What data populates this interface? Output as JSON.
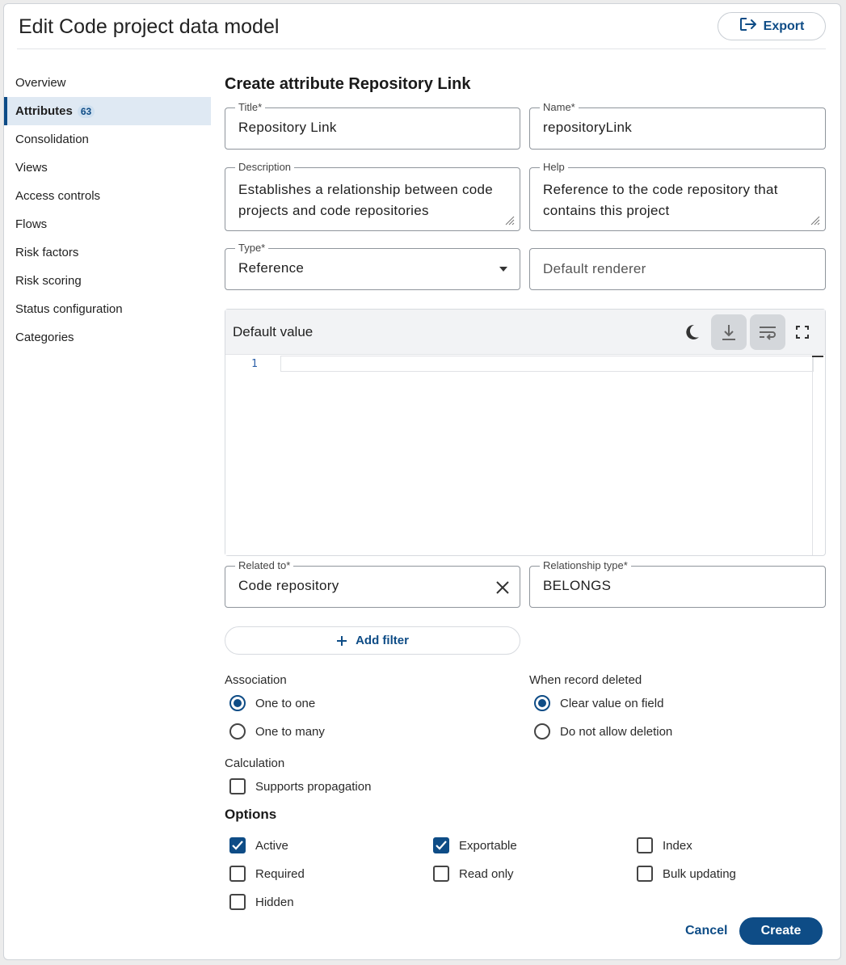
{
  "header": {
    "title": "Edit Code project data model",
    "export_label": "Export"
  },
  "sidebar": {
    "items": [
      {
        "label": "Overview"
      },
      {
        "label": "Attributes",
        "badge": "63",
        "active": true
      },
      {
        "label": "Consolidation"
      },
      {
        "label": "Views"
      },
      {
        "label": "Access controls"
      },
      {
        "label": "Flows"
      },
      {
        "label": "Risk factors"
      },
      {
        "label": "Risk scoring"
      },
      {
        "label": "Status configuration"
      },
      {
        "label": "Categories"
      }
    ]
  },
  "form": {
    "section_title": "Create attribute Repository Link",
    "title_label": "Title*",
    "title_value": "Repository Link",
    "name_label": "Name*",
    "name_value": "repositoryLink",
    "description_label": "Description",
    "description_value": "Establishes a relationship between code projects and code repositories",
    "help_label": "Help",
    "help_value": "Reference to the code repository that contains this project",
    "type_label": "Type*",
    "type_value": "Reference",
    "renderer_placeholder": "Default renderer",
    "default_value_label": "Default value",
    "line_number": "1",
    "related_label": "Related to*",
    "related_value": "Code repository",
    "reltype_label": "Relationship type*",
    "reltype_value": "BELONGS",
    "add_filter_label": "Add filter"
  },
  "association": {
    "label": "Association",
    "options": [
      "One to one",
      "One to many"
    ],
    "selected": "One to one"
  },
  "deleted": {
    "label": "When record deleted",
    "options": [
      "Clear value on field",
      "Do not allow deletion"
    ],
    "selected": "Clear value on field"
  },
  "calculation": {
    "label": "Calculation",
    "supports_propagation": "Supports propagation"
  },
  "options": {
    "title": "Options",
    "active": "Active",
    "exportable": "Exportable",
    "index": "Index",
    "required": "Required",
    "read_only": "Read only",
    "bulk_updating": "Bulk updating",
    "hidden": "Hidden"
  },
  "footer": {
    "cancel_label": "Cancel",
    "create_label": "Create"
  },
  "colors": {
    "accent": "#0e4c86",
    "active_nav_bg": "#dfe9f3"
  }
}
